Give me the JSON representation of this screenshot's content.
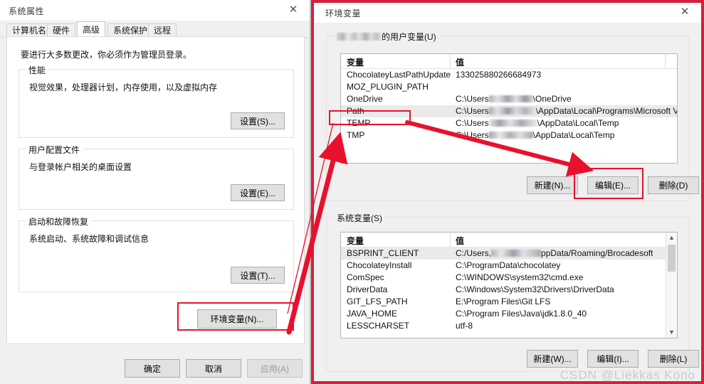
{
  "system_properties": {
    "title": "系统属性",
    "close_icon": "close-icon",
    "tabs": [
      {
        "label": "计算机名",
        "active": false
      },
      {
        "label": "硬件",
        "active": false
      },
      {
        "label": "高级",
        "active": true
      },
      {
        "label": "系统保护",
        "active": false
      },
      {
        "label": "远程",
        "active": false
      }
    ],
    "intro": "要进行大多数更改，你必须作为管理员登录。",
    "groups": [
      {
        "legend": "性能",
        "desc": "视觉效果，处理器计划，内存使用，以及虚拟内存",
        "button": "设置(S)..."
      },
      {
        "legend": "用户配置文件",
        "desc": "与登录帐户相关的桌面设置",
        "button": "设置(E)..."
      },
      {
        "legend": "启动和故障恢复",
        "desc": "系统启动、系统故障和调试信息",
        "button": "设置(T)..."
      }
    ],
    "env_button": "环境变量(N)...",
    "footer": {
      "ok": "确定",
      "cancel": "取消",
      "apply": "应用(A)",
      "apply_disabled": true
    }
  },
  "environment_variables": {
    "title": "环境变量",
    "close_icon": "close-icon",
    "user_section": {
      "legend_suffix": "的用户变量(U)",
      "username_redacted": true,
      "columns": [
        "变量",
        "值"
      ],
      "rows": [
        {
          "name": "ChocolateyLastPathUpdate",
          "value": "133025880266684973",
          "selected": false,
          "redacted": false
        },
        {
          "name": "MOZ_PLUGIN_PATH",
          "value": "",
          "selected": false,
          "redacted": false
        },
        {
          "name": "OneDrive",
          "value_prefix": "C:\\Users",
          "value_suffix": "\\OneDrive",
          "selected": false,
          "redacted": true
        },
        {
          "name": "Path",
          "value_prefix": "C:\\Users",
          "value_suffix": "\\AppData\\Local\\Programs\\Microsoft VS ...",
          "selected": true,
          "redacted": true
        },
        {
          "name": "TEMP",
          "value_prefix": "C:\\Users",
          "value_suffix": "\\AppData\\Local\\Temp",
          "selected": false,
          "redacted": true
        },
        {
          "name": "TMP",
          "value_prefix": "C:\\Users",
          "value_suffix": "\\AppData\\Local\\Temp",
          "selected": false,
          "redacted": true
        }
      ],
      "buttons": {
        "new": "新建(N)...",
        "edit": "编辑(E)...",
        "delete": "删除(D)"
      }
    },
    "system_section": {
      "legend": "系统变量(S)",
      "columns": [
        "变量",
        "值"
      ],
      "rows": [
        {
          "name": "BSPRINT_CLIENT",
          "value_prefix": "C:/Users,",
          "value_suffix": "ppData/Roaming/Brocadesoft",
          "selected": true,
          "redacted": true
        },
        {
          "name": "ChocolateyInstall",
          "value": "C:\\ProgramData\\chocolatey",
          "selected": false,
          "redacted": false
        },
        {
          "name": "ComSpec",
          "value": "C:\\WINDOWS\\system32\\cmd.exe",
          "selected": false,
          "redacted": false
        },
        {
          "name": "DriverData",
          "value": "C:\\Windows\\System32\\Drivers\\DriverData",
          "selected": false,
          "redacted": false
        },
        {
          "name": "GIT_LFS_PATH",
          "value": "E:\\Program Files\\Git LFS",
          "selected": false,
          "redacted": false
        },
        {
          "name": "JAVA_HOME",
          "value": "C:\\Program Files\\Java\\jdk1.8.0_40",
          "selected": false,
          "redacted": false
        },
        {
          "name": "LESSCHARSET",
          "value": "utf-8",
          "selected": false,
          "redacted": false
        }
      ],
      "scrollbar": {
        "up_icon": "chevron-up-icon",
        "down_icon": "chevron-down-icon"
      },
      "buttons": {
        "new": "新建(W)...",
        "edit": "编辑(I)...",
        "delete": "删除(L)"
      }
    }
  },
  "watermark": "CSDN @Liekkas Kono",
  "annotations": {
    "highlight_color": "#e8112d",
    "frame_color": "#d5203c",
    "arrow_color": "#e8112d",
    "boxes": [
      "env-button-highlight",
      "path-row-highlight",
      "edit-button-highlight"
    ],
    "arrows": [
      "env-button-to-path-row",
      "path-row-to-edit-button"
    ]
  }
}
